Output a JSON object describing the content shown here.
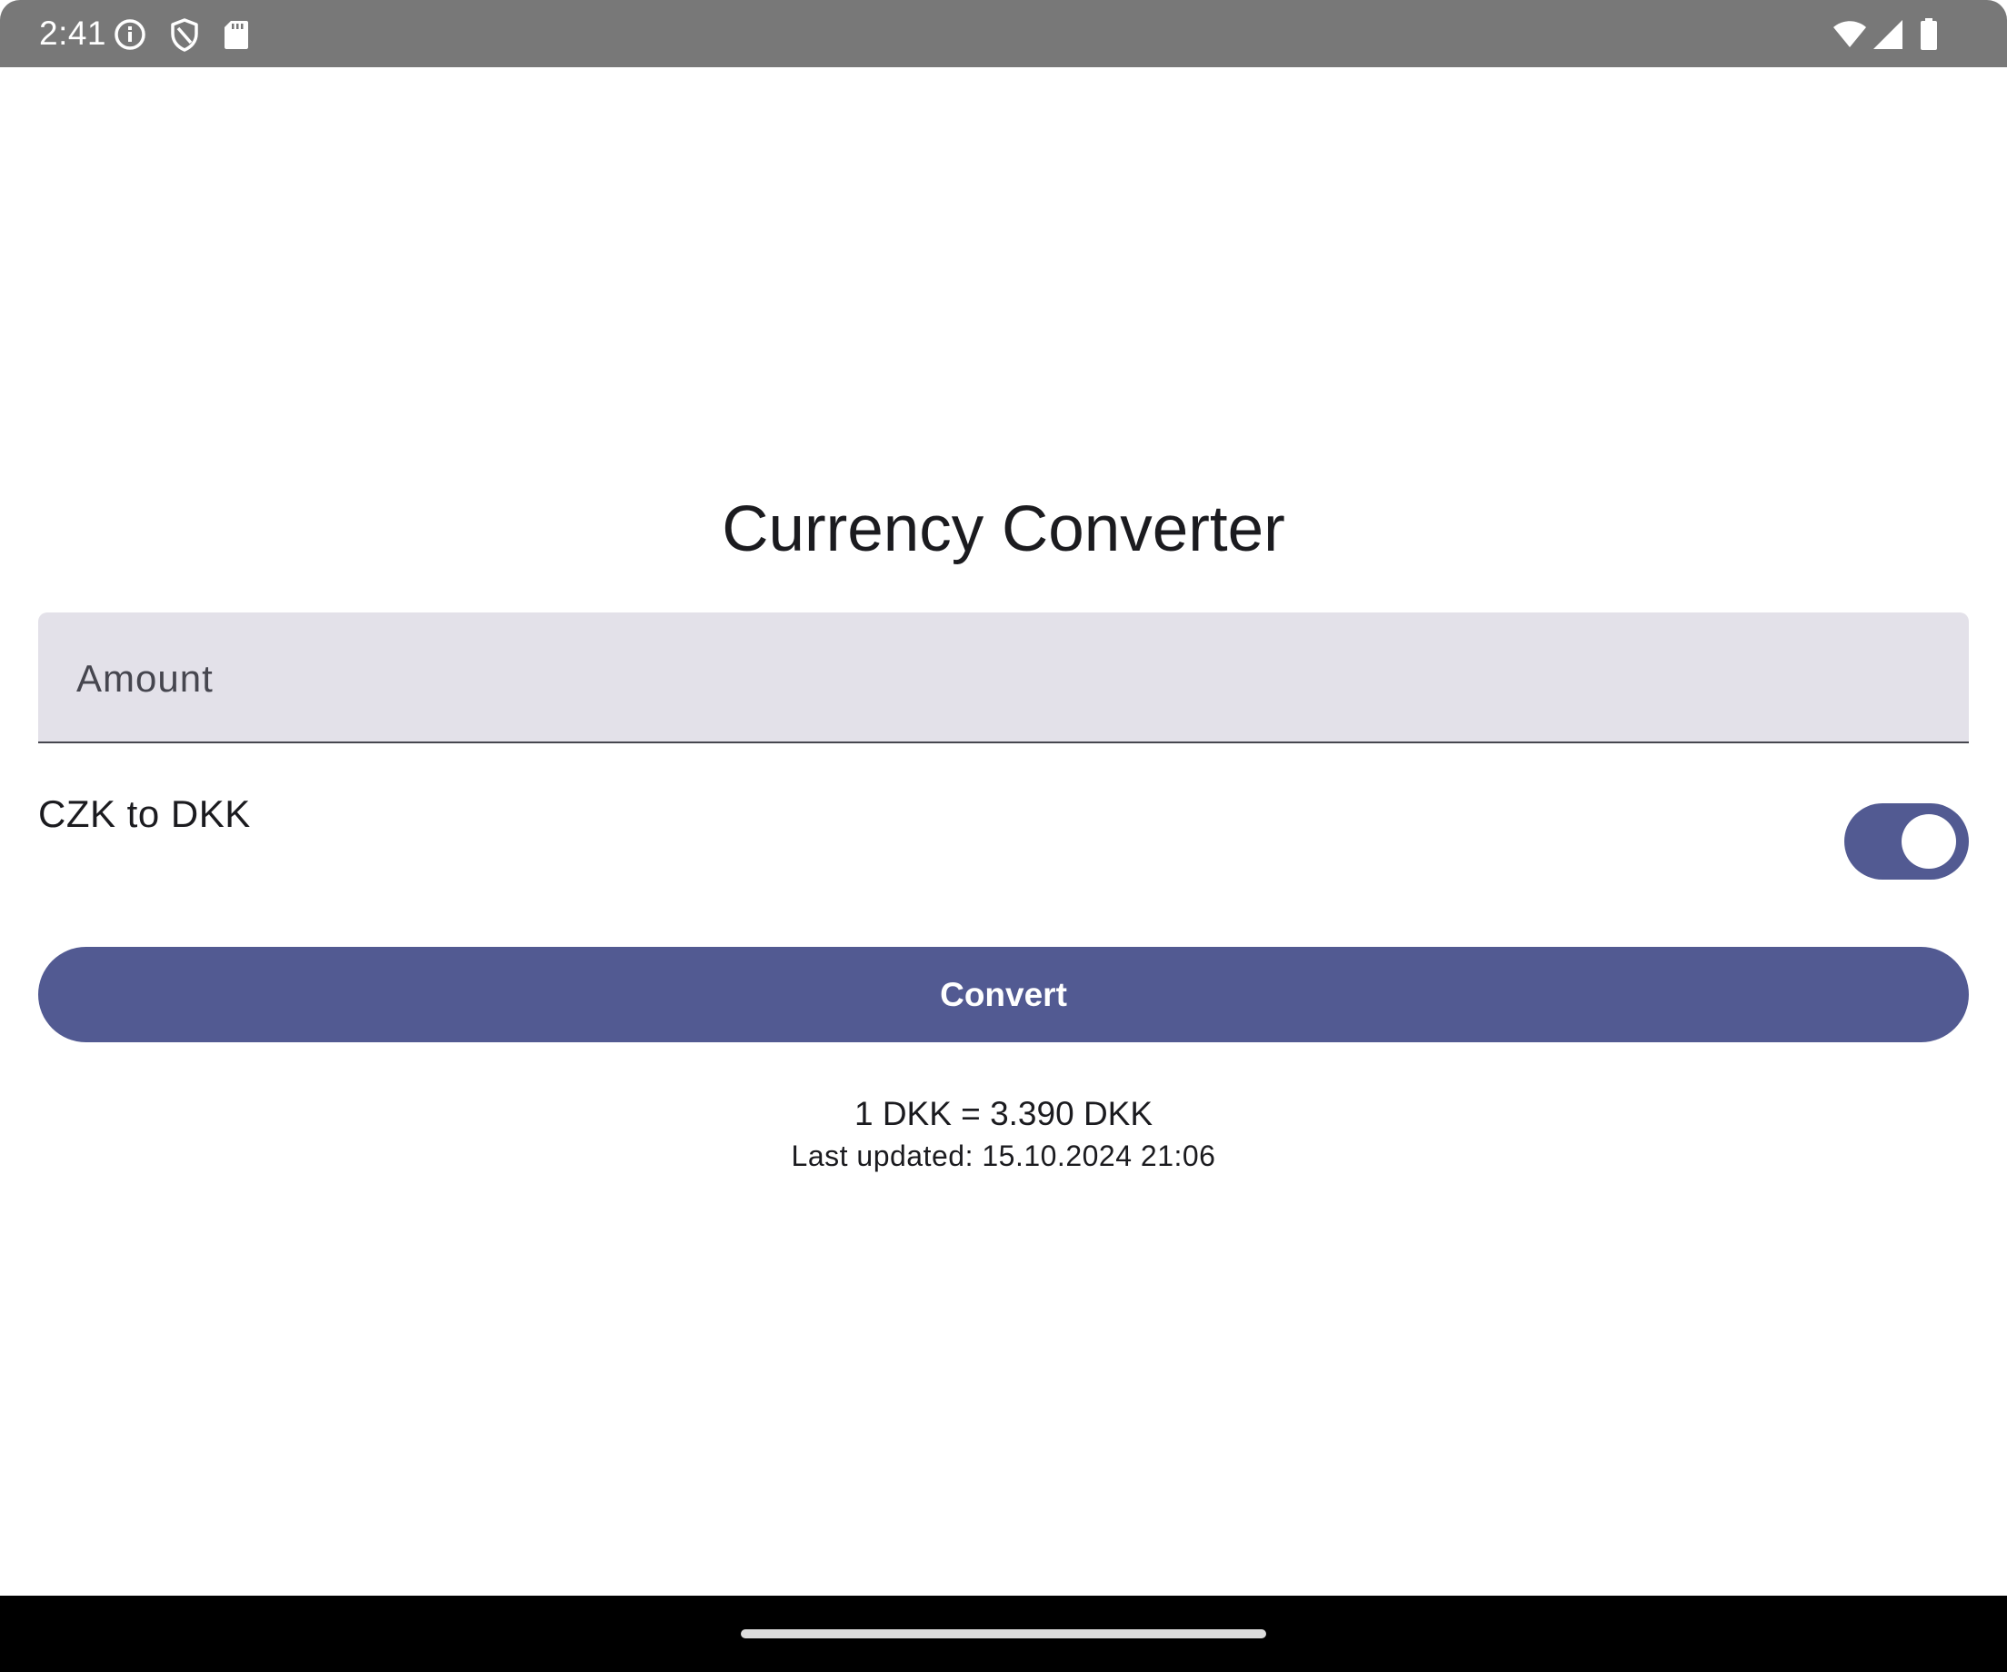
{
  "status_bar": {
    "time": "2:41",
    "left_icons": [
      "info-icon",
      "shield-icon",
      "sd-card-icon"
    ],
    "right_icons": [
      "wifi-icon",
      "signal-icon",
      "battery-icon"
    ]
  },
  "app": {
    "title": "Currency Converter",
    "amount_field": {
      "placeholder": "Amount",
      "value": ""
    },
    "direction": {
      "label": "CZK to DKK",
      "toggle_on": true
    },
    "convert_button": {
      "label": "Convert"
    },
    "result": {
      "rate_text": "1 DKK = 3.390 DKK",
      "last_updated": "Last updated: 15.10.2024 21:06"
    }
  },
  "colors": {
    "status_bar": "#787878",
    "accent": "#525a92",
    "field_background": "#e3e1e9",
    "nav_bar": "#000000"
  }
}
